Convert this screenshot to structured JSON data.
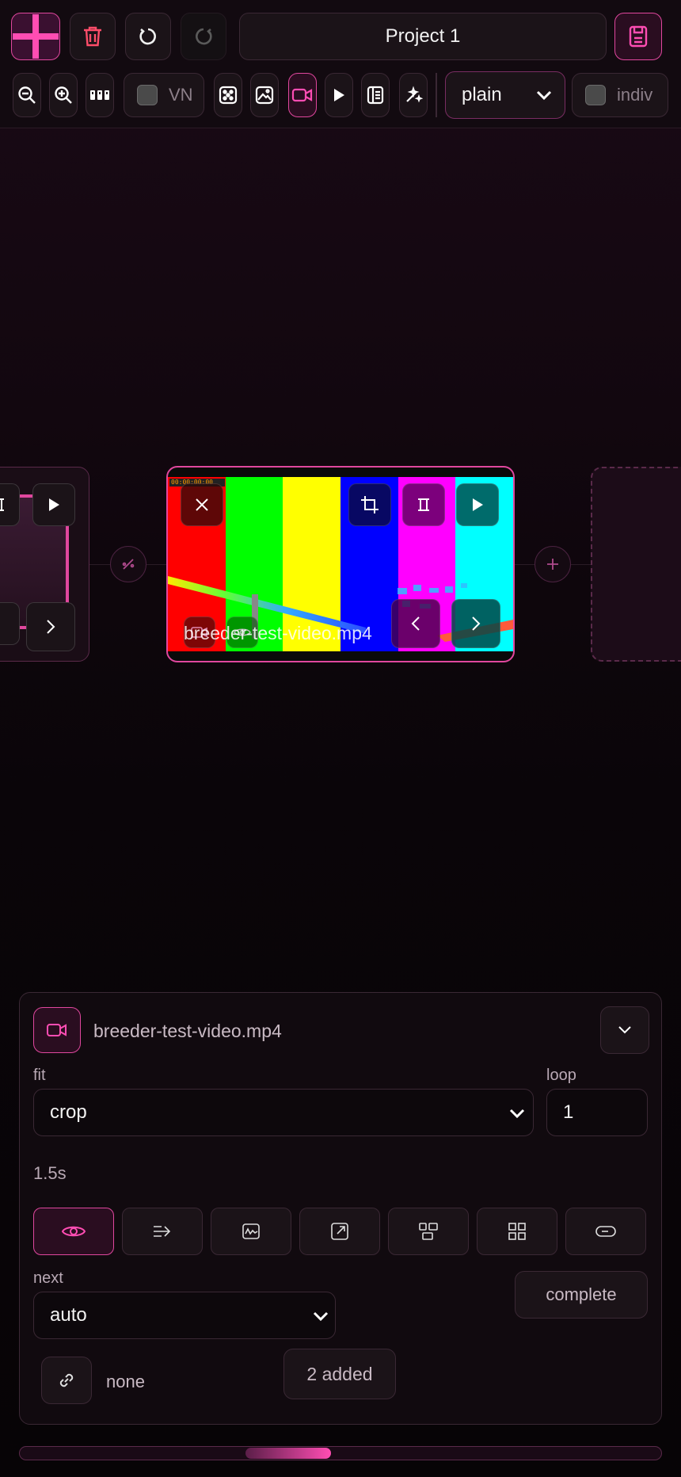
{
  "header": {
    "project_title": "Project 1",
    "vn_label": "VN",
    "mode_select_value": "plain",
    "indiv_label": "indiv"
  },
  "canvas": {
    "main_node": {
      "filename": "breeder-test-video.mp4",
      "timecode": "00:00:00:00"
    }
  },
  "panel": {
    "filename": "breeder-test-video.mp4",
    "fit_label": "fit",
    "fit_value": "crop",
    "loop_label": "loop",
    "loop_value": "1",
    "duration": "1.5s",
    "next_label": "next",
    "next_value": "auto",
    "complete_label": "complete",
    "link_value": "none",
    "added_label": "2 added"
  },
  "colors": {
    "accent": "#ff4db3",
    "accent_border": "#e0479e",
    "background": "#0a0509"
  },
  "scrollbar": {
    "position_fraction": 0.37
  }
}
